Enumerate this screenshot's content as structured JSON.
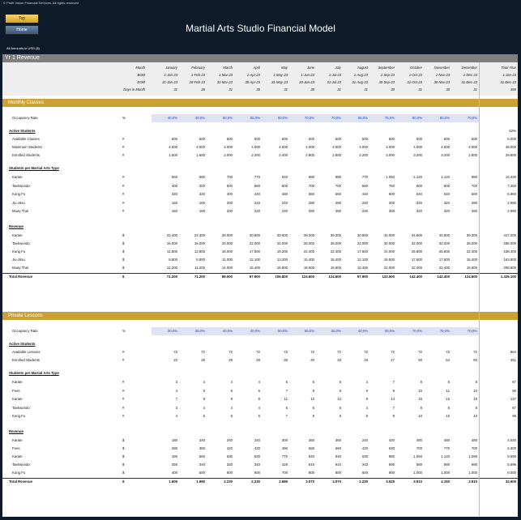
{
  "copyright": "© Profit Vision Financial Services. All rights reserved.",
  "nav": {
    "top_label": "Top",
    "home_label": "Home"
  },
  "title": "Martial Arts Studio Financial Model",
  "amounts_note": "All Amounts in  USD ($)",
  "section_title": "Yr 1 Revenue",
  "header": {
    "row_labels": [
      "Month",
      "BOM",
      "EOM",
      "Days in Month"
    ],
    "months": [
      "January",
      "February",
      "March",
      "April",
      "May",
      "June",
      "July",
      "August",
      "September",
      "October",
      "November",
      "December"
    ],
    "bom": [
      "1-Jan-23",
      "1-Feb-23",
      "1-Mar-23",
      "1-Apr-23",
      "1-May-23",
      "1-Jun-23",
      "1-Jul-23",
      "1-Aug-23",
      "1-Sep-23",
      "1-Oct-23",
      "1-Nov-23",
      "1-Dec-23"
    ],
    "eom": [
      "31-Jan-23",
      "28-Feb-23",
      "31-Mar-23",
      "30-Apr-23",
      "31-May-23",
      "30-Jun-23",
      "31-Jul-23",
      "31-Aug-23",
      "30-Sep-23",
      "31-Oct-23",
      "30-Nov-23",
      "31-Dec-23"
    ],
    "days": [
      "31",
      "28",
      "31",
      "30",
      "31",
      "30",
      "31",
      "31",
      "30",
      "31",
      "30",
      "31"
    ],
    "total_col": [
      "Total Year",
      "1-Jan-23",
      "31-Dec-23",
      "365"
    ]
  },
  "monthly": {
    "title": "Monthly Classes",
    "occupancy": {
      "label": "Occupancy Rate",
      "unit": "%",
      "values": [
        "40,0%",
        "40,0%",
        "50,0%",
        "55,0%",
        "60,0%",
        "70,0%",
        "70,0%",
        "55,0%",
        "75,0%",
        "80,0%",
        "80,0%",
        "70,0%"
      ],
      "total": ""
    },
    "pct_total": "62%",
    "active_title": "Active Students",
    "active": [
      {
        "label": "Available Classes",
        "unit": "#",
        "values": [
          "500",
          "500",
          "500",
          "500",
          "500",
          "500",
          "500",
          "500",
          "500",
          "500",
          "500",
          "500"
        ],
        "total": "6.000"
      },
      {
        "label": "Maximum Students",
        "unit": "#",
        "values": [
          "4.000",
          "4.000",
          "4.000",
          "4.000",
          "4.000",
          "4.000",
          "4.000",
          "4.000",
          "4.000",
          "4.000",
          "4.000",
          "4.000"
        ],
        "total": "48.000"
      },
      {
        "label": "Enrolled Students",
        "unit": "#",
        "values": [
          "1.600",
          "1.600",
          "2.000",
          "2.200",
          "2.400",
          "2.800",
          "2.800",
          "2.200",
          "3.000",
          "3.200",
          "3.200",
          "2.800"
        ],
        "total": "29.800"
      }
    ],
    "per_type_title": "Students per Martial Arts Type",
    "per_type": [
      {
        "label": "Karate",
        "unit": "#",
        "values": [
          "560",
          "560",
          "700",
          "770",
          "840",
          "980",
          "980",
          "770",
          "1.050",
          "1.120",
          "1.120",
          "980"
        ],
        "total": "10.430"
      },
      {
        "label": "Taekwondo",
        "unit": "#",
        "values": [
          "400",
          "400",
          "500",
          "550",
          "600",
          "700",
          "700",
          "550",
          "750",
          "800",
          "800",
          "700"
        ],
        "total": "7.450"
      },
      {
        "label": "Kung Fu",
        "unit": "#",
        "values": [
          "320",
          "320",
          "400",
          "440",
          "480",
          "560",
          "560",
          "440",
          "600",
          "640",
          "640",
          "560"
        ],
        "total": "5.960"
      },
      {
        "label": "Jiu-Jitsu",
        "unit": "#",
        "values": [
          "160",
          "160",
          "200",
          "220",
          "240",
          "280",
          "280",
          "220",
          "300",
          "320",
          "320",
          "280"
        ],
        "total": "2.980"
      },
      {
        "label": "Muay Thai",
        "unit": "#",
        "values": [
          "160",
          "160",
          "200",
          "220",
          "240",
          "280",
          "280",
          "220",
          "300",
          "320",
          "320",
          "280"
        ],
        "total": "2.980"
      }
    ],
    "revenue_title": "Revenue",
    "revenue": [
      {
        "label": "Karate",
        "unit": "$",
        "values": [
          "22.400",
          "22.400",
          "28.000",
          "30.800",
          "33.600",
          "39.200",
          "39.200",
          "30.800",
          "42.000",
          "44.800",
          "44.800",
          "39.200"
        ],
        "total": "417.200"
      },
      {
        "label": "Taekwondo",
        "unit": "$",
        "values": [
          "16.000",
          "16.000",
          "20.000",
          "22.000",
          "24.000",
          "28.000",
          "28.000",
          "22.000",
          "30.000",
          "32.000",
          "32.000",
          "28.000"
        ],
        "total": "298.000"
      },
      {
        "label": "Kung Fu",
        "unit": "$",
        "values": [
          "11.800",
          "12.800",
          "16.000",
          "17.600",
          "19.200",
          "22.400",
          "22.400",
          "17.600",
          "24.000",
          "25.600",
          "25.600",
          "22.400"
        ],
        "total": "238.400"
      },
      {
        "label": "Jiu-Jitsu",
        "unit": "$",
        "values": [
          "8.800",
          "8.800",
          "11.000",
          "12.100",
          "13.200",
          "15.400",
          "15.400",
          "12.100",
          "16.500",
          "17.600",
          "17.600",
          "15.400"
        ],
        "total": "163.900"
      },
      {
        "label": "Muay Thai",
        "unit": "$",
        "values": [
          "11.200",
          "11.200",
          "14.000",
          "15.400",
          "16.800",
          "19.600",
          "19.600",
          "15.400",
          "21.000",
          "22.400",
          "22.400",
          "19.600"
        ],
        "total": "208.600"
      }
    ],
    "total_revenue": {
      "label": "Total Revenue",
      "unit": "$",
      "values": [
        "71.200",
        "71.200",
        "89.000",
        "97.900",
        "106.800",
        "124.600",
        "124.600",
        "97.900",
        "133.500",
        "142.400",
        "142.400",
        "124.600"
      ],
      "total": "1.326.100"
    }
  },
  "private": {
    "title": "Private Lessons",
    "occupancy": {
      "label": "Occupancy Rate",
      "unit": "%",
      "values": [
        "30,0%",
        "35,0%",
        "40,0%",
        "40,0%",
        "50,0%",
        "55,0%",
        "55,0%",
        "40,0%",
        "65,0%",
        "70,0%",
        "75,0%",
        "70,0%"
      ],
      "total": ""
    },
    "active_title": "Active Students",
    "active": [
      {
        "label": "Available Lessons",
        "unit": "#",
        "values": [
          "72",
          "72",
          "72",
          "72",
          "72",
          "72",
          "72",
          "72",
          "72",
          "72",
          "72",
          "72"
        ],
        "total": "864"
      },
      {
        "label": "Enrolled Students",
        "unit": "#",
        "values": [
          "22",
          "25",
          "29",
          "29",
          "36",
          "40",
          "40",
          "29",
          "47",
          "50",
          "54",
          "50"
        ],
        "total": "451"
      }
    ],
    "per_type_title": "Students per Martial Arts Type",
    "per_type": [
      {
        "label": "Karate",
        "unit": "#",
        "values": [
          "3",
          "4",
          "4",
          "4",
          "5",
          "6",
          "6",
          "4",
          "7",
          "8",
          "8",
          "8"
        ],
        "total": "67"
      },
      {
        "label": "Fees",
        "unit": "#",
        "values": [
          "4",
          "5",
          "6",
          "6",
          "7",
          "8",
          "8",
          "6",
          "9",
          "10",
          "11",
          "10"
        ],
        "total": "90"
      },
      {
        "label": "Karate",
        "unit": "#",
        "values": [
          "7",
          "8",
          "9",
          "9",
          "11",
          "12",
          "12",
          "9",
          "14",
          "15",
          "16",
          "15"
        ],
        "total": "137"
      },
      {
        "label": "Taekwondo",
        "unit": "#",
        "values": [
          "3",
          "4",
          "4",
          "4",
          "5",
          "6",
          "6",
          "4",
          "7",
          "8",
          "8",
          "8"
        ],
        "total": "67"
      },
      {
        "label": "Kung Fu",
        "unit": "#",
        "values": [
          "4",
          "5",
          "6",
          "6",
          "7",
          "8",
          "8",
          "6",
          "9",
          "10",
          "10",
          "10"
        ],
        "total": "90"
      }
    ],
    "revenue_title": "Revenue",
    "revenue": [
      {
        "label": "Karate",
        "unit": "$",
        "values": [
          "180",
          "240",
          "240",
          "240",
          "300",
          "360",
          "360",
          "240",
          "420",
          "480",
          "480",
          "480"
        ],
        "total": "4.020"
      },
      {
        "label": "Fees",
        "unit": "$",
        "values": [
          "280",
          "350",
          "420",
          "420",
          "490",
          "560",
          "560",
          "420",
          "630",
          "700",
          "770",
          "700"
        ],
        "total": "6.300"
      },
      {
        "label": "Karate",
        "unit": "$",
        "values": [
          "490",
          "560",
          "630",
          "630",
          "770",
          "840",
          "840",
          "630",
          "980",
          "1.050",
          "1.120",
          "1.050"
        ],
        "total": "9.590"
      },
      {
        "label": "Taekwondo",
        "unit": "$",
        "values": [
          "255",
          "340",
          "340",
          "340",
          "425",
          "510",
          "510",
          "340",
          "595",
          "680",
          "680",
          "680"
        ],
        "total": "5.695"
      },
      {
        "label": "Kung Fu",
        "unit": "$",
        "values": [
          "400",
          "500",
          "600",
          "600",
          "700",
          "800",
          "800",
          "600",
          "900",
          "1.000",
          "1.000",
          "1.000"
        ],
        "total": "9.000"
      }
    ],
    "total_revenue": {
      "label": "Total Revenue",
      "unit": "$",
      "values": [
        "1.605",
        "1.990",
        "2.230",
        "2.230",
        "2.685",
        "3.070",
        "3.070",
        "2.230",
        "3.525",
        "3.910",
        "4.150",
        "3.910"
      ],
      "total": "34.605"
    }
  }
}
